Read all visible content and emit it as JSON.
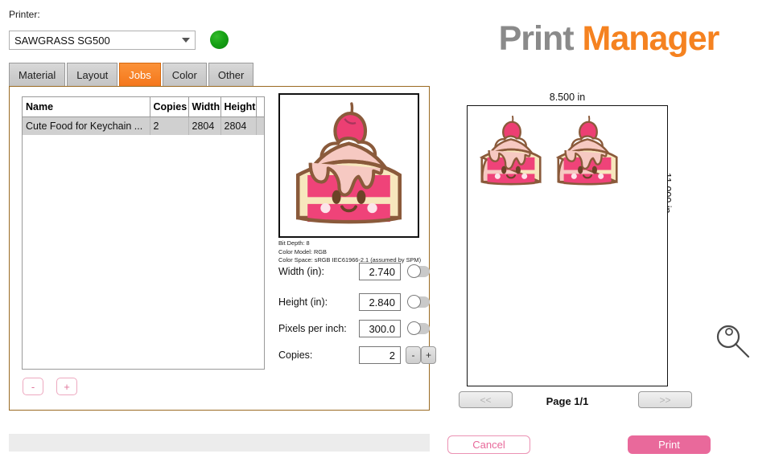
{
  "printer": {
    "label": "Printer:",
    "selected": "SAWGRASS SG500",
    "status_color": "#17a215",
    "options": [
      "SAWGRASS SG500"
    ]
  },
  "tabs": [
    {
      "label": "Material",
      "active": false
    },
    {
      "label": "Layout",
      "active": false
    },
    {
      "label": "Jobs",
      "active": true
    },
    {
      "label": "Color",
      "active": false
    },
    {
      "label": "Other",
      "active": false
    }
  ],
  "jobs_table": {
    "columns": [
      "Name",
      "Copies",
      "Width",
      "Height"
    ],
    "rows": [
      {
        "name": "Cute Food for Keychain ...",
        "copies": "2",
        "width": "2804",
        "height": "2804"
      }
    ]
  },
  "list_controls": {
    "remove_label": "-",
    "add_label": "+"
  },
  "image_meta": {
    "bit_depth": "Bit Depth: 8",
    "color_model": "Color Model: RGB",
    "color_space": "Color Space: sRGB IEC61966-2.1 (assumed by SPM)"
  },
  "properties": {
    "width": {
      "label": "Width (in):",
      "value": "2.740",
      "toggle": "off"
    },
    "height": {
      "label": "Height (in):",
      "value": "2.840",
      "toggle": "off"
    },
    "ppi": {
      "label": "Pixels per inch:",
      "value": "300.0",
      "toggle": "off"
    },
    "copies": {
      "label": "Copies:",
      "value": "2",
      "minus": "-",
      "plus": "+"
    }
  },
  "app": {
    "title_part1": "Print ",
    "title_part2": "Manager",
    "brand_gray": "#8a8a8a",
    "brand_orange": "#f58220"
  },
  "preview": {
    "page_width": "8.500 in",
    "page_height": "11.000 in",
    "prev_label": "<<",
    "next_label": ">>",
    "page_indicator": "Page 1/1",
    "copies_on_sheet": 2
  },
  "actions": {
    "cancel": "Cancel",
    "print": "Print",
    "accent_pink": "#e9699b"
  },
  "icons": {
    "dropdown": "chevron-down-icon",
    "status": "status-led-icon",
    "zoom": "magnifier-icon"
  }
}
